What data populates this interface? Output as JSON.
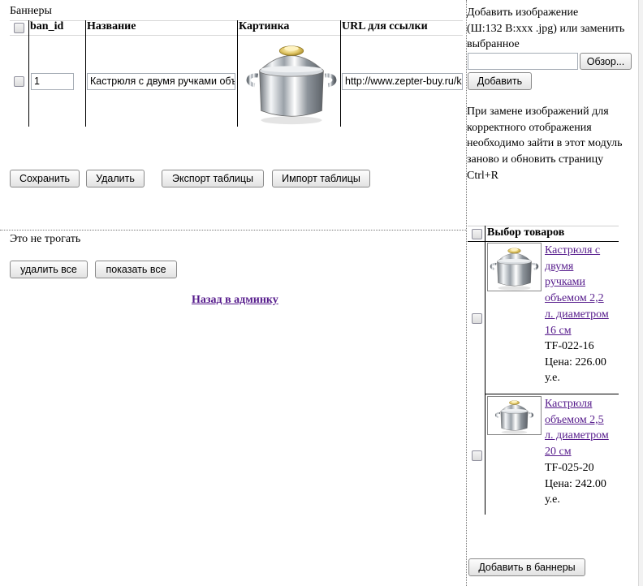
{
  "banners": {
    "section_title": "Баннеры",
    "columns": [
      "ban_id",
      "Название",
      "Картинка",
      "URL для ссылки"
    ],
    "row": {
      "ban_id": "1",
      "name": "Кастрюля с двумя ручками объемом",
      "url": "http://www.zepter-buy.ru/ka",
      "image": "pot-with-two-handles-icon"
    },
    "buttons": {
      "save": "Сохранить",
      "delete": "Удалить",
      "export": "Экспорт таблицы",
      "import": "Импорт таблицы"
    }
  },
  "misc": {
    "dont_touch": "Это не трогать",
    "delete_all": "удалить все",
    "show_all": "показать все",
    "back_link": "Назад в админку"
  },
  "upload": {
    "hint_line1": "Добавить изображение",
    "hint_line2": "(Ш:132 В:xxx .jpg) или заменить",
    "hint_line3": "выбранное",
    "browse": "Обзор...",
    "add": "Добавить",
    "note_line1": "При замене изображений для",
    "note_line2": "корректного отображения",
    "note_line3": "необходимо зайти в этот модуль",
    "note_line4": "заново и обновить страницу",
    "note_line5": "Ctrl+R"
  },
  "products": {
    "header": "Выбор товаров",
    "items": [
      {
        "title_lines": [
          "Кастрюля с",
          "двумя",
          "ручками",
          "объемом 2,2",
          "л. диаметром",
          "16 см"
        ],
        "sku": "TF-022-16",
        "price_line1": "Цена: 226.00",
        "price_line2": "у.е."
      },
      {
        "title_lines": [
          "Кастрюля",
          "объемом 2,5",
          "л. диаметром",
          "20 см"
        ],
        "sku": "TF-025-20",
        "price_line1": "Цена: 242.00",
        "price_line2": "у.е."
      }
    ],
    "add_to_banners": "Добавить в баннеры"
  },
  "colors": {
    "link": "#551a8b",
    "steel": "#c8cdd2",
    "knob": "#e0c76a"
  }
}
